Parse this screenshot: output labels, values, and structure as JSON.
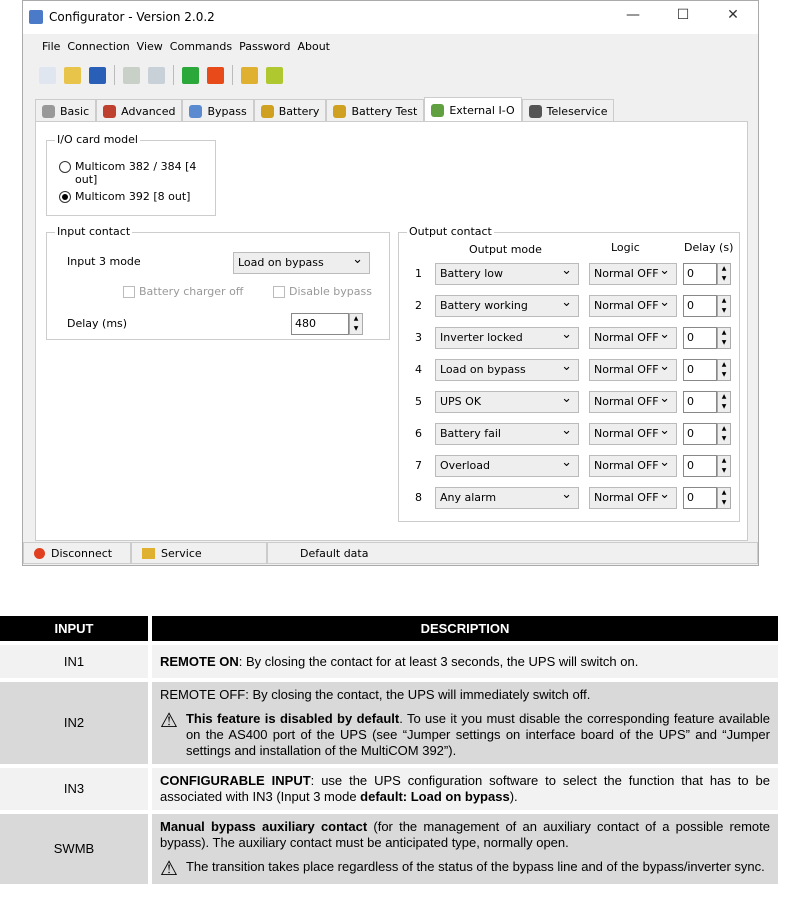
{
  "window": {
    "title": "Configurator - Version 2.0.2",
    "controls": [
      "—",
      "☐",
      "✕"
    ]
  },
  "menu": [
    "File",
    "Connection",
    "View",
    "Commands",
    "Password",
    "About"
  ],
  "toolbar": [
    {
      "icon": "new-icon",
      "color": "#dfe6f0"
    },
    {
      "icon": "open-icon",
      "color": "#e8c44a"
    },
    {
      "icon": "save-icon",
      "color": "#2a5fb8"
    },
    {
      "icon": "read-icon",
      "color": "#c8d0c8"
    },
    {
      "icon": "write-icon",
      "color": "#c8d0d8"
    },
    {
      "icon": "play-icon",
      "color": "#2aa83a"
    },
    {
      "icon": "stop-icon",
      "color": "#e84a1a"
    },
    {
      "icon": "key-icon",
      "color": "#e0b030"
    },
    {
      "icon": "add-key-icon",
      "color": "#b0c830"
    }
  ],
  "tabs": [
    {
      "label": "Basic",
      "color": "#999"
    },
    {
      "label": "Advanced",
      "color": "#c04030"
    },
    {
      "label": "Bypass",
      "color": "#5a8ad0"
    },
    {
      "label": "Battery",
      "color": "#d0a020"
    },
    {
      "label": "Battery Test",
      "color": "#d0a020"
    },
    {
      "label": "External I-O",
      "color": "#60a040",
      "active": true
    },
    {
      "label": "Teleservice",
      "color": "#555"
    }
  ],
  "io_card": {
    "legend": "I/O card model",
    "options": [
      {
        "label": "Multicom 382 / 384 [4 out]",
        "checked": false
      },
      {
        "label": "Multicom 392 [8 out]",
        "checked": true
      }
    ]
  },
  "input_contact": {
    "legend": "Input contact",
    "mode_label": "Input 3 mode",
    "mode_value": "Load on bypass",
    "chk1": "Battery charger off",
    "chk2": "Disable bypass",
    "delay_label": "Delay (ms)",
    "delay_value": "480"
  },
  "output_contact": {
    "legend": "Output contact",
    "headers": [
      "Output mode",
      "Logic",
      "Delay (s)"
    ],
    "rows": [
      {
        "n": "1",
        "mode": "Battery low",
        "logic": "Normal OFF",
        "delay": "0"
      },
      {
        "n": "2",
        "mode": "Battery working",
        "logic": "Normal OFF",
        "delay": "0"
      },
      {
        "n": "3",
        "mode": "Inverter locked",
        "logic": "Normal OFF",
        "delay": "0"
      },
      {
        "n": "4",
        "mode": "Load on bypass",
        "logic": "Normal OFF",
        "delay": "0"
      },
      {
        "n": "5",
        "mode": "UPS OK",
        "logic": "Normal OFF",
        "delay": "0"
      },
      {
        "n": "6",
        "mode": "Battery fail",
        "logic": "Normal OFF",
        "delay": "0"
      },
      {
        "n": "7",
        "mode": "Overload",
        "logic": "Normal OFF",
        "delay": "0"
      },
      {
        "n": "8",
        "mode": "Any alarm",
        "logic": "Normal OFF",
        "delay": "0"
      }
    ]
  },
  "status": {
    "disconnect": "Disconnect",
    "service": "Service",
    "info": "Default data"
  },
  "table": {
    "headers": [
      "INPUT",
      "DESCRIPTION"
    ],
    "in1": {
      "label": "IN1",
      "bold": "REMOTE ON",
      "text": ": By closing the contact for at least 3 seconds, the UPS will switch on."
    },
    "in2": {
      "label": "IN2",
      "text": "REMOTE OFF: By closing the contact, the UPS will immediately switch off.",
      "warn_bold": "This feature is disabled by default",
      "warn_text": ". To use it you must disable the corresponding feature available on the AS400 port of the UPS (see “Jumper settings on interface board of the UPS” and “Jumper settings and installation of the MultiCOM 392”)."
    },
    "in3": {
      "label": "IN3",
      "bold": "CONFIGURABLE INPUT",
      "text": ": use the UPS configuration software to select the function that has to be associated with IN3 (Input 3 mode ",
      "bold2": "default: Load on bypass",
      "end": ")."
    },
    "swmb": {
      "label": "SWMB",
      "bold": "Manual bypass auxiliary contact",
      "text": " (for the management of an auxiliary contact of a possible remote bypass). The auxiliary contact must be anticipated type, normally open.",
      "warn_text": "The transition takes place regardless of the status of the bypass line and of the bypass/inverter sync."
    }
  }
}
